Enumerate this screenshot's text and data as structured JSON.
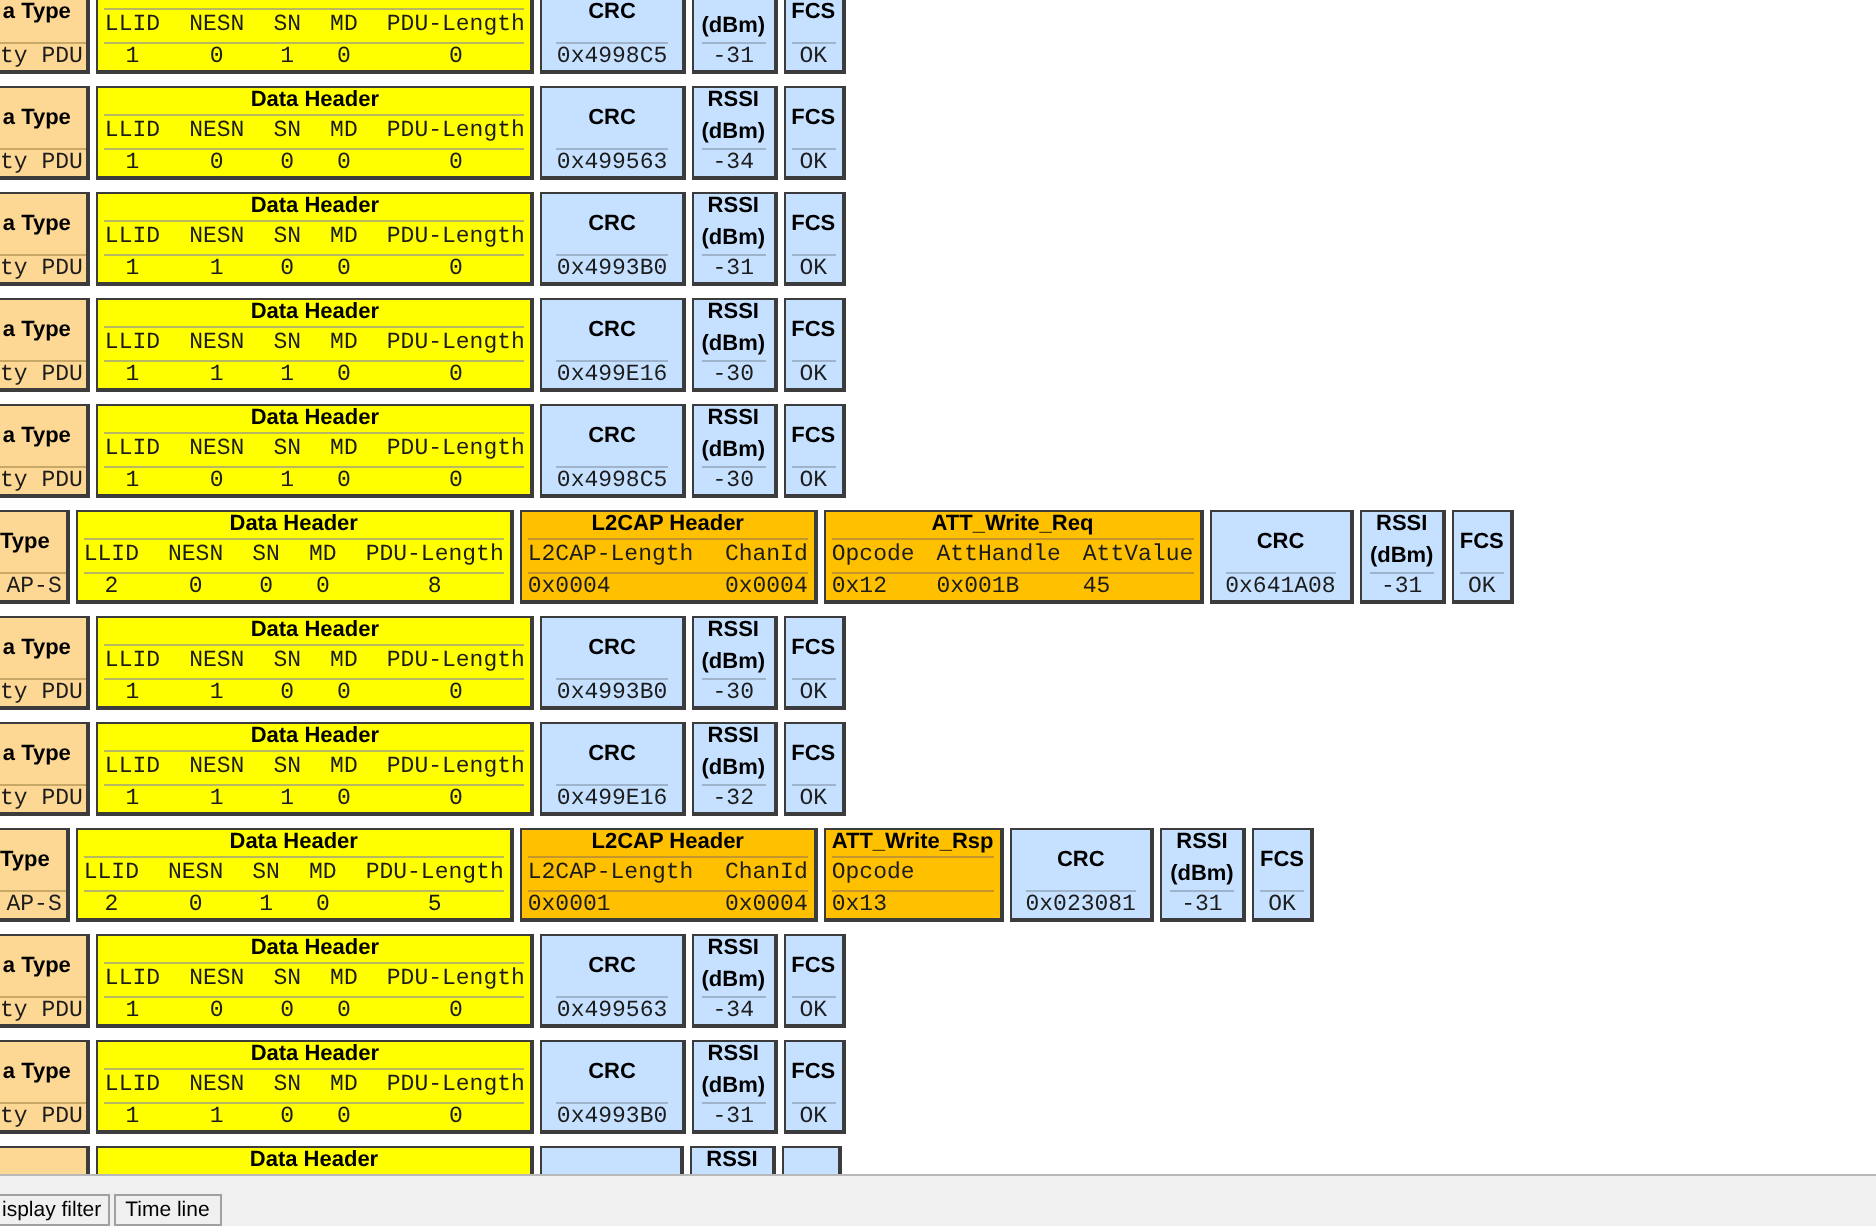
{
  "packets": [
    {
      "blocks": [
        {
          "kind": "type",
          "title": "a Type",
          "value": "ty PDU"
        },
        {
          "kind": "data_header",
          "columns": [
            {
              "label": "LLID",
              "value": "1"
            },
            {
              "label": "NESN",
              "value": "0"
            },
            {
              "label": "SN",
              "value": "1"
            },
            {
              "label": "MD",
              "value": "0"
            },
            {
              "label": "PDU-Length",
              "value": "0"
            }
          ]
        },
        {
          "kind": "crc",
          "title": "CRC",
          "value": "0x4998C5"
        },
        {
          "kind": "rssi",
          "unit": "(dBm)",
          "value": "-31"
        },
        {
          "kind": "fcs",
          "title": "FCS",
          "value": "OK"
        }
      ]
    },
    {
      "blocks": [
        {
          "kind": "type",
          "title": "a Type",
          "value": "ty PDU"
        },
        {
          "kind": "data_header",
          "title": "Data Header",
          "columns": [
            {
              "label": "LLID",
              "value": "1"
            },
            {
              "label": "NESN",
              "value": "0"
            },
            {
              "label": "SN",
              "value": "0"
            },
            {
              "label": "MD",
              "value": "0"
            },
            {
              "label": "PDU-Length",
              "value": "0"
            }
          ]
        },
        {
          "kind": "crc",
          "title": "CRC",
          "value": "0x499563"
        },
        {
          "kind": "rssi",
          "title": "RSSI",
          "unit": "(dBm)",
          "value": "-34"
        },
        {
          "kind": "fcs",
          "title": "FCS",
          "value": "OK"
        }
      ]
    },
    {
      "blocks": [
        {
          "kind": "type",
          "title": "a Type",
          "value": "ty PDU"
        },
        {
          "kind": "data_header",
          "title": "Data Header",
          "columns": [
            {
              "label": "LLID",
              "value": "1"
            },
            {
              "label": "NESN",
              "value": "1"
            },
            {
              "label": "SN",
              "value": "0"
            },
            {
              "label": "MD",
              "value": "0"
            },
            {
              "label": "PDU-Length",
              "value": "0"
            }
          ]
        },
        {
          "kind": "crc",
          "title": "CRC",
          "value": "0x4993B0"
        },
        {
          "kind": "rssi",
          "title": "RSSI",
          "unit": "(dBm)",
          "value": "-31"
        },
        {
          "kind": "fcs",
          "title": "FCS",
          "value": "OK"
        }
      ]
    },
    {
      "blocks": [
        {
          "kind": "type",
          "title": "a Type",
          "value": "ty PDU"
        },
        {
          "kind": "data_header",
          "title": "Data Header",
          "columns": [
            {
              "label": "LLID",
              "value": "1"
            },
            {
              "label": "NESN",
              "value": "1"
            },
            {
              "label": "SN",
              "value": "1"
            },
            {
              "label": "MD",
              "value": "0"
            },
            {
              "label": "PDU-Length",
              "value": "0"
            }
          ]
        },
        {
          "kind": "crc",
          "title": "CRC",
          "value": "0x499E16"
        },
        {
          "kind": "rssi",
          "title": "RSSI",
          "unit": "(dBm)",
          "value": "-30"
        },
        {
          "kind": "fcs",
          "title": "FCS",
          "value": "OK"
        }
      ]
    },
    {
      "blocks": [
        {
          "kind": "type",
          "title": "a Type",
          "value": "ty PDU"
        },
        {
          "kind": "data_header",
          "title": "Data Header",
          "columns": [
            {
              "label": "LLID",
              "value": "1"
            },
            {
              "label": "NESN",
              "value": "0"
            },
            {
              "label": "SN",
              "value": "1"
            },
            {
              "label": "MD",
              "value": "0"
            },
            {
              "label": "PDU-Length",
              "value": "0"
            }
          ]
        },
        {
          "kind": "crc",
          "title": "CRC",
          "value": "0x4998C5"
        },
        {
          "kind": "rssi",
          "title": "RSSI",
          "unit": "(dBm)",
          "value": "-30"
        },
        {
          "kind": "fcs",
          "title": "FCS",
          "value": "OK"
        }
      ]
    },
    {
      "blocks": [
        {
          "kind": "type",
          "title": "Type",
          "value": "AP-S"
        },
        {
          "kind": "data_header",
          "title": "Data Header",
          "columns": [
            {
              "label": "LLID",
              "value": "2"
            },
            {
              "label": "NESN",
              "value": "0"
            },
            {
              "label": "SN",
              "value": "0"
            },
            {
              "label": "MD",
              "value": "0"
            },
            {
              "label": "PDU-Length",
              "value": "8"
            }
          ]
        },
        {
          "kind": "l2cap_header",
          "title": "L2CAP Header",
          "columns": [
            {
              "label": "L2CAP-Length",
              "value": "0x0004"
            },
            {
              "label": "ChanId",
              "value": "0x0004"
            }
          ]
        },
        {
          "kind": "att",
          "title": "ATT_Write_Req",
          "columns": [
            {
              "label": "Opcode",
              "value": "0x12"
            },
            {
              "label": "AttHandle",
              "value": "0x001B"
            },
            {
              "label": "AttValue",
              "value": "45"
            }
          ]
        },
        {
          "kind": "crc",
          "title": "CRC",
          "value": "0x641A08"
        },
        {
          "kind": "rssi",
          "title": "RSSI",
          "unit": "(dBm)",
          "value": "-31"
        },
        {
          "kind": "fcs",
          "title": "FCS",
          "value": "OK"
        }
      ]
    },
    {
      "blocks": [
        {
          "kind": "type",
          "title": "a Type",
          "value": "ty PDU"
        },
        {
          "kind": "data_header",
          "title": "Data Header",
          "columns": [
            {
              "label": "LLID",
              "value": "1"
            },
            {
              "label": "NESN",
              "value": "1"
            },
            {
              "label": "SN",
              "value": "0"
            },
            {
              "label": "MD",
              "value": "0"
            },
            {
              "label": "PDU-Length",
              "value": "0"
            }
          ]
        },
        {
          "kind": "crc",
          "title": "CRC",
          "value": "0x4993B0"
        },
        {
          "kind": "rssi",
          "title": "RSSI",
          "unit": "(dBm)",
          "value": "-30"
        },
        {
          "kind": "fcs",
          "title": "FCS",
          "value": "OK"
        }
      ]
    },
    {
      "blocks": [
        {
          "kind": "type",
          "title": "a Type",
          "value": "ty PDU"
        },
        {
          "kind": "data_header",
          "title": "Data Header",
          "columns": [
            {
              "label": "LLID",
              "value": "1"
            },
            {
              "label": "NESN",
              "value": "1"
            },
            {
              "label": "SN",
              "value": "1"
            },
            {
              "label": "MD",
              "value": "0"
            },
            {
              "label": "PDU-Length",
              "value": "0"
            }
          ]
        },
        {
          "kind": "crc",
          "title": "CRC",
          "value": "0x499E16"
        },
        {
          "kind": "rssi",
          "title": "RSSI",
          "unit": "(dBm)",
          "value": "-32"
        },
        {
          "kind": "fcs",
          "title": "FCS",
          "value": "OK"
        }
      ]
    },
    {
      "blocks": [
        {
          "kind": "type",
          "title": "Type",
          "value": "AP-S"
        },
        {
          "kind": "data_header",
          "title": "Data Header",
          "columns": [
            {
              "label": "LLID",
              "value": "2"
            },
            {
              "label": "NESN",
              "value": "0"
            },
            {
              "label": "SN",
              "value": "1"
            },
            {
              "label": "MD",
              "value": "0"
            },
            {
              "label": "PDU-Length",
              "value": "5"
            }
          ]
        },
        {
          "kind": "l2cap_header",
          "title": "L2CAP Header",
          "columns": [
            {
              "label": "L2CAP-Length",
              "value": "0x0001"
            },
            {
              "label": "ChanId",
              "value": "0x0004"
            }
          ]
        },
        {
          "kind": "att",
          "title": "ATT_Write_Rsp",
          "columns": [
            {
              "label": "Opcode",
              "value": "0x13"
            }
          ]
        },
        {
          "kind": "crc",
          "title": "CRC",
          "value": "0x023081"
        },
        {
          "kind": "rssi",
          "title": "RSSI",
          "unit": "(dBm)",
          "value": "-31"
        },
        {
          "kind": "fcs",
          "title": "FCS",
          "value": "OK"
        }
      ]
    },
    {
      "blocks": [
        {
          "kind": "type",
          "title": "a Type",
          "value": "ty PDU"
        },
        {
          "kind": "data_header",
          "title": "Data Header",
          "columns": [
            {
              "label": "LLID",
              "value": "1"
            },
            {
              "label": "NESN",
              "value": "0"
            },
            {
              "label": "SN",
              "value": "0"
            },
            {
              "label": "MD",
              "value": "0"
            },
            {
              "label": "PDU-Length",
              "value": "0"
            }
          ]
        },
        {
          "kind": "crc",
          "title": "CRC",
          "value": "0x499563"
        },
        {
          "kind": "rssi",
          "title": "RSSI",
          "unit": "(dBm)",
          "value": "-34"
        },
        {
          "kind": "fcs",
          "title": "FCS",
          "value": "OK"
        }
      ]
    },
    {
      "blocks": [
        {
          "kind": "type",
          "title": "a Type",
          "value": "ty PDU"
        },
        {
          "kind": "data_header",
          "title": "Data Header",
          "columns": [
            {
              "label": "LLID",
              "value": "1"
            },
            {
              "label": "NESN",
              "value": "1"
            },
            {
              "label": "SN",
              "value": "0"
            },
            {
              "label": "MD",
              "value": "0"
            },
            {
              "label": "PDU-Length",
              "value": "0"
            }
          ]
        },
        {
          "kind": "crc",
          "title": "CRC",
          "value": "0x4993B0"
        },
        {
          "kind": "rssi",
          "title": "RSSI",
          "unit": "(dBm)",
          "value": "-31"
        },
        {
          "kind": "fcs",
          "title": "FCS",
          "value": "OK"
        }
      ]
    },
    {
      "blocks": [
        {
          "kind": "type"
        },
        {
          "kind": "data_header",
          "title": "Data Header"
        },
        {
          "kind": "crc"
        },
        {
          "kind": "rssi",
          "title": "RSSI"
        },
        {
          "kind": "fcs"
        }
      ]
    }
  ],
  "bottom_tabs": [
    {
      "label": "isplay filter",
      "selected": false
    },
    {
      "label": "Time line",
      "selected": false
    }
  ]
}
